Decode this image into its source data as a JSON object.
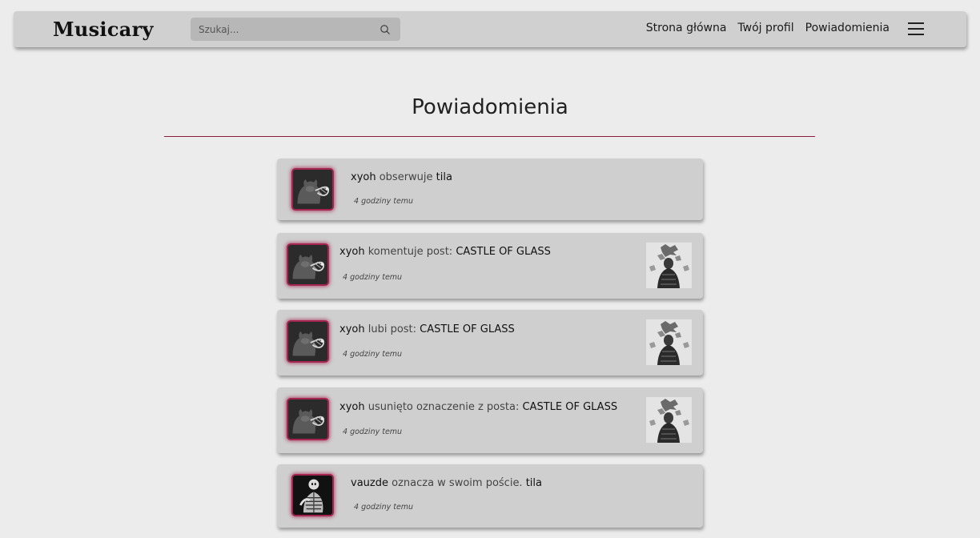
{
  "brand": {
    "name": "Musicary"
  },
  "search": {
    "placeholder": "Szukaj..."
  },
  "nav": {
    "home": "Strona główna",
    "profile": "Twój profil",
    "notifications": "Powiadomienia"
  },
  "page": {
    "title": "Powiadomienia"
  },
  "colors": {
    "accent": "#a32550",
    "navbar": "#d0d0d0",
    "card": "#cfcfcf",
    "background": "#ececec"
  },
  "notifications": [
    {
      "user": "xyoh",
      "action": " obserwuje ",
      "target": "tila",
      "time": "4 godziny temu",
      "avatar_icon": "cat-avatar-icon",
      "has_thumbnail": false
    },
    {
      "user": "xyoh",
      "action": " komentuje post: ",
      "target": "CASTLE OF GLASS",
      "time": "4 godziny temu",
      "avatar_icon": "cat-avatar-icon",
      "has_thumbnail": true
    },
    {
      "user": "xyoh",
      "action": " lubi post: ",
      "target": "CASTLE OF GLASS",
      "time": "4 godziny temu",
      "avatar_icon": "cat-avatar-icon",
      "has_thumbnail": true
    },
    {
      "user": "xyoh",
      "action": " usunięto oznaczenie z posta: ",
      "target": "CASTLE OF GLASS",
      "time": "4 godziny temu",
      "avatar_icon": "cat-avatar-icon",
      "has_thumbnail": true
    },
    {
      "user": "vauzde",
      "action": " oznacza w swoim poście. ",
      "target": "tila",
      "time": "4 godziny temu",
      "avatar_icon": "skeleton-avatar-icon",
      "has_thumbnail": false
    }
  ]
}
